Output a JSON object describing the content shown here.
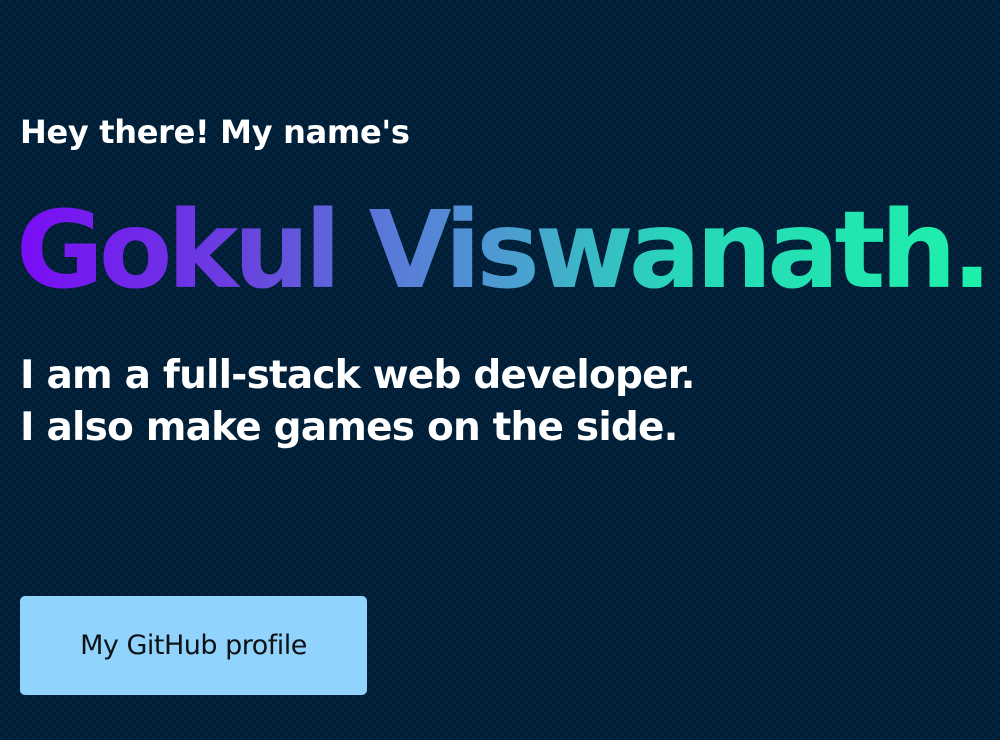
{
  "hero": {
    "greeting": "Hey there! My name's",
    "name": "Gokul Viswanath.",
    "tagline_line1": "I am a full-stack web developer.",
    "tagline_line2": "I also make games on the side.",
    "cta_label": "My GitHub profile"
  },
  "colors": {
    "background": "#022440",
    "text": "#ffffff",
    "name_gradient_start": "#7a0cf5",
    "name_gradient_end": "#1ef0aa",
    "button_background": "#90d3fc",
    "button_text": "#0d1216"
  }
}
